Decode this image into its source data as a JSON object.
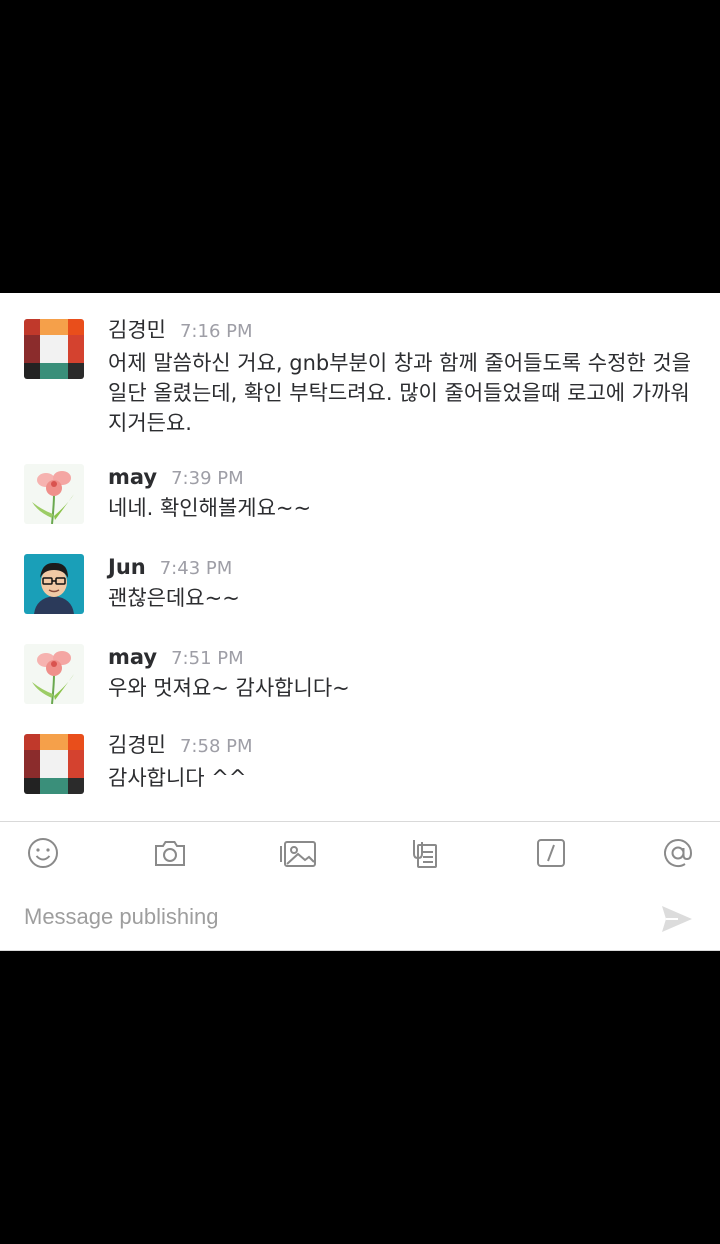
{
  "messages": [
    {
      "sender": "김경민",
      "time": "7:16 PM",
      "text": "어제 말씀하신 거요, gnb부분이 창과 함께 줄어들도록 수정한 것을 일단 올렸는데, 확인 부탁드려요. 많이 줄어들었을때 로고에 가까워 지거든요.",
      "avatar": "grid-logo-avatar"
    },
    {
      "sender": "may",
      "time": "7:39 PM",
      "text": "네네. 확인해볼게요~~",
      "avatar": "flower-avatar"
    },
    {
      "sender": "Jun",
      "time": "7:43 PM",
      "text": "괜찮은데요~~",
      "avatar": "cartoon-face-avatar"
    },
    {
      "sender": "may",
      "time": "7:51 PM",
      "text": "우와 멋져요~ 감사합니다~",
      "avatar": "flower-avatar"
    },
    {
      "sender": "김경민",
      "time": "7:58 PM",
      "text": "감사합니다 ^^",
      "avatar": "grid-logo-avatar"
    }
  ],
  "composer": {
    "placeholder": "Message publishing",
    "icons": [
      "emoji-icon",
      "camera-icon",
      "photo-library-icon",
      "snippet-icon",
      "slash-command-icon",
      "mention-icon"
    ],
    "send_icon": "send-icon"
  },
  "colors": {
    "text": "#2c2d30",
    "muted": "#9e9ea6",
    "icon": "#8a8a8a"
  }
}
